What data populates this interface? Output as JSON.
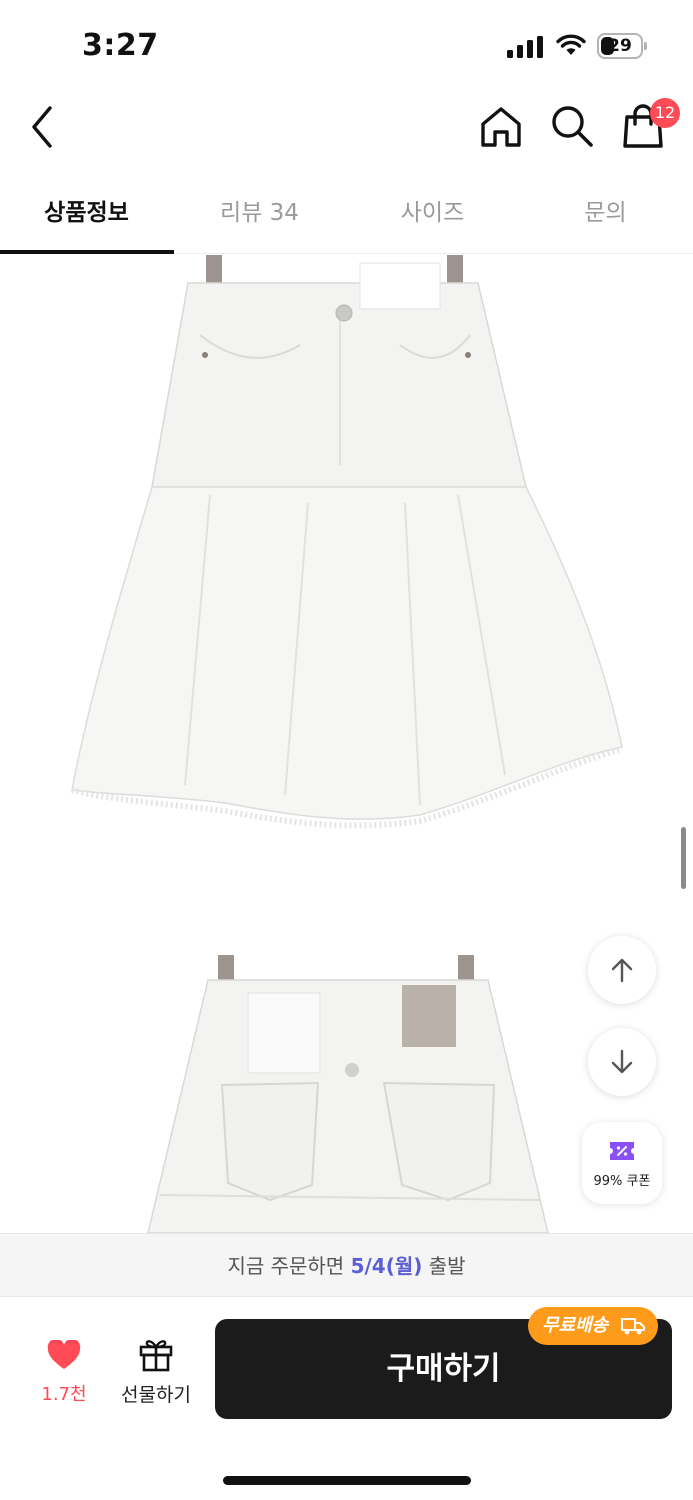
{
  "status_bar": {
    "time": "3:27",
    "battery": "29"
  },
  "header": {
    "cart_count": "12"
  },
  "tabs": [
    {
      "label": "상품정보",
      "active": true
    },
    {
      "label": "리뷰 34",
      "active": false
    },
    {
      "label": "사이즈",
      "active": false
    },
    {
      "label": "문의",
      "active": false
    }
  ],
  "product_images": [
    {
      "icon": "white-denim-skirt-front"
    },
    {
      "icon": "white-denim-skirt-back"
    }
  ],
  "floating": {
    "up_icon": "arrow-up-icon",
    "down_icon": "arrow-down-icon",
    "coupon_label": "99% 쿠폰"
  },
  "delivery": {
    "prefix": "지금 주문하면",
    "date": "5/4(월)",
    "suffix": "출발"
  },
  "actions": {
    "like_count": "1.7천",
    "gift_label": "선물하기",
    "buy_label": "구매하기",
    "shipping_badge": "무료배송"
  },
  "colors": {
    "accent": "#ff4b55",
    "delivery_date": "#5b5fd6",
    "buy_button": "#1b1b1b",
    "shipping_badge": "#ff9b1a",
    "coupon": "#8a4ff7"
  }
}
